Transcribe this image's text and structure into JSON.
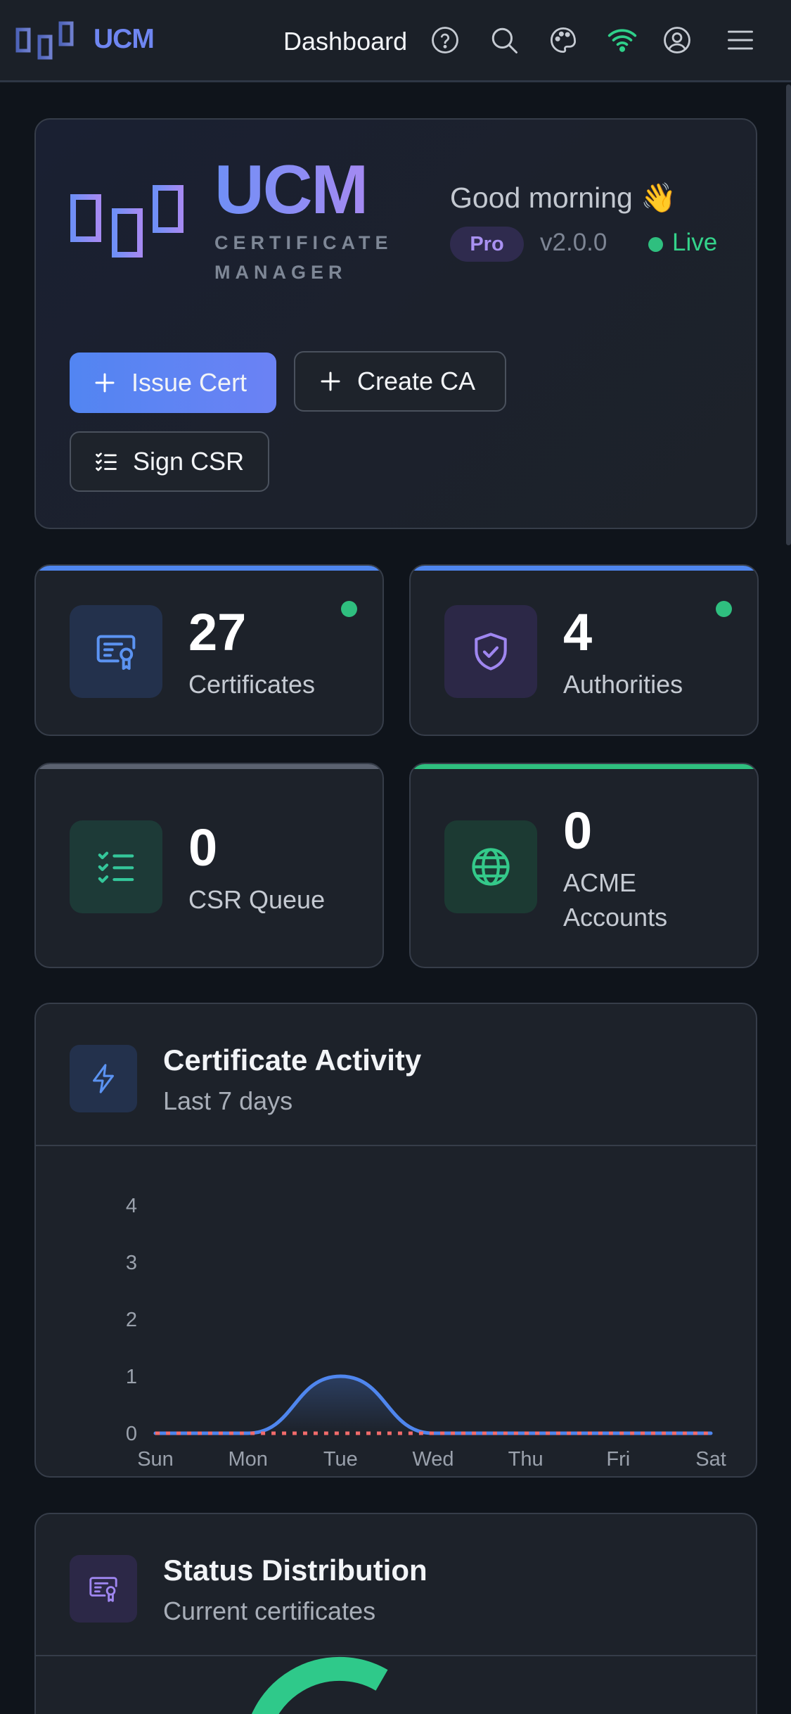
{
  "topbar": {
    "brand": "UCM",
    "page_title": "Dashboard",
    "icons": [
      "logo-icon",
      "help-icon",
      "search-icon",
      "palette-icon",
      "wifi-icon",
      "user-icon",
      "menu-icon"
    ]
  },
  "hero": {
    "wordmark": "UCM",
    "subtitle": "CERTIFICATE MANAGER",
    "greeting": "Good morning 👋",
    "plan": "Pro",
    "version": "v2.0.0",
    "status": "Live",
    "buttons": {
      "issue_cert": "Issue Cert",
      "create_ca": "Create CA",
      "sign_csr": "Sign CSR"
    }
  },
  "stats": [
    {
      "value": "27",
      "label": "Certificates",
      "icon": "certificate-icon",
      "accent": "#4f86ee",
      "online": true
    },
    {
      "value": "4",
      "label": "Authorities",
      "icon": "shield-check-icon",
      "accent": "#4f86ee",
      "online": true
    },
    {
      "value": "0",
      "label": "CSR Queue",
      "icon": "list-check-icon",
      "accent": "#5b6270",
      "online": false
    },
    {
      "value": "0",
      "label": "ACME Accounts",
      "icon": "globe-icon",
      "accent": "#2fbf7f",
      "online": false
    }
  ],
  "activity": {
    "title": "Certificate Activity",
    "subtitle": "Last 7 days"
  },
  "distribution": {
    "title": "Status Distribution",
    "subtitle": "Current certificates"
  },
  "colors": {
    "primary": "#5285f2",
    "violet": "#a58af2",
    "success": "#2fbf7f",
    "danger": "#f26b6b"
  },
  "chart_data": {
    "type": "line",
    "categories": [
      "Sun",
      "Mon",
      "Tue",
      "Wed",
      "Thu",
      "Fri",
      "Sat"
    ],
    "series": [
      {
        "values": [
          0,
          0,
          1,
          0,
          0,
          0,
          0
        ],
        "color": "#4f86ee",
        "style": "solid",
        "fill": true
      },
      {
        "values": [
          0,
          0,
          0,
          0,
          0,
          0,
          0
        ],
        "color": "#f26b6b",
        "style": "dotted"
      }
    ],
    "ylim": [
      0,
      4
    ],
    "yticks": [
      "0",
      "1",
      "2",
      "3",
      "4"
    ],
    "grid": false
  }
}
